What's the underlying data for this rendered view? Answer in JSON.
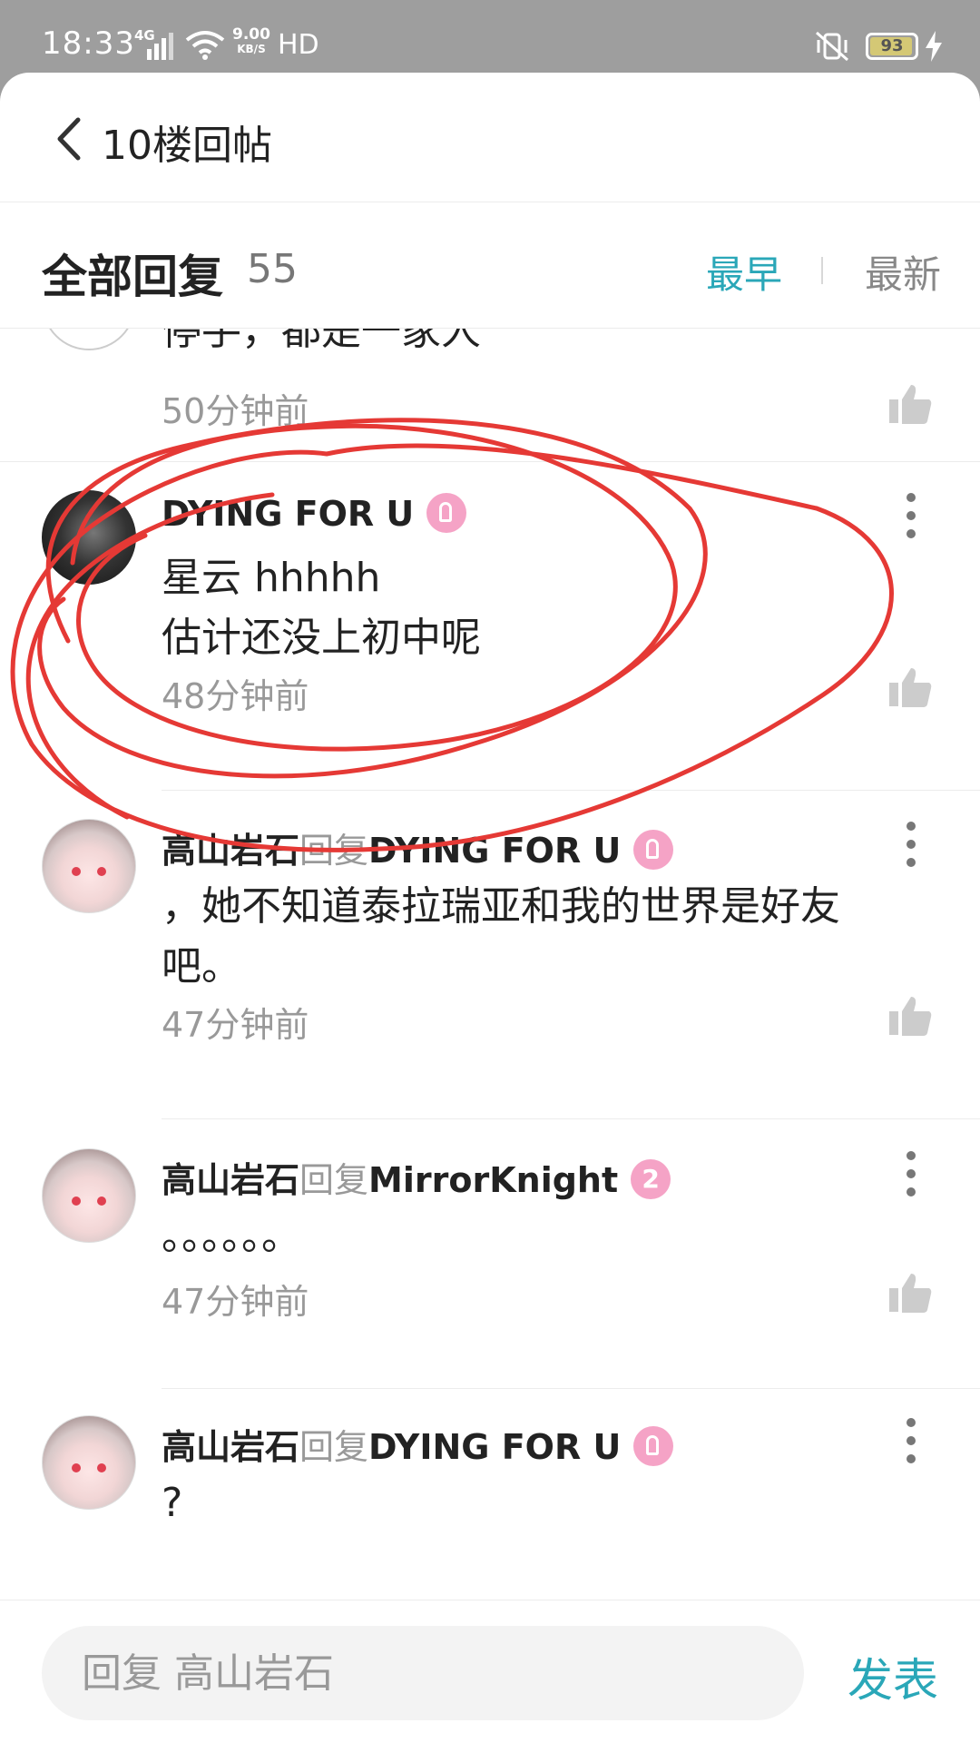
{
  "status_bar": {
    "time": "18:33",
    "network": "4G",
    "speed_value": "9.00",
    "speed_unit": "KB/S",
    "hd": "HD",
    "battery": "93"
  },
  "header": {
    "title": "10楼回帖"
  },
  "replies": {
    "title": "全部回复",
    "count": "55",
    "sort_earliest": "最早",
    "sort_newest": "最新",
    "accent_color": "#2aa7b8"
  },
  "comments": [
    {
      "text": "停手，都是一家人",
      "time": "50分钟前"
    },
    {
      "user": "DYING FOR U",
      "text": "星云 hhhhh\n估计还没上初中呢",
      "time": "48分钟前"
    },
    {
      "user": "高山岩石",
      "reply_word": "回复",
      "reply_to": "DYING FOR U",
      "text": "，她不知道泰拉瑞亚和我的世界是好友\n吧。",
      "time": "47分钟前"
    },
    {
      "user": "高山岩石",
      "reply_word": "回复",
      "reply_to": "MirrorKnight",
      "badge": "2",
      "text": "。。。。。。",
      "time": "47分钟前"
    },
    {
      "user": "高山岩石",
      "reply_word": "回复",
      "reply_to": "DYING FOR U",
      "text": "?"
    }
  ],
  "composer": {
    "placeholder": "回复 高山岩石",
    "send_label": "发表"
  },
  "annotation_color": "#e53935"
}
